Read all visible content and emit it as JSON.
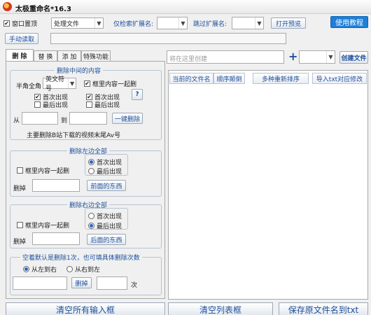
{
  "window": {
    "title": "太极重命名*16.3"
  },
  "toolbar": {
    "topmost_label": "窗口置顶",
    "topmost_checked": true,
    "mode_value": "处理文件",
    "ext_only_label": "仅检索扩展名:",
    "ext_skip_label": "跳过扩展名:",
    "preview_button": "打开预览",
    "tutorial_button": "使用教程",
    "manual_read_button": "手动读取"
  },
  "tabs": [
    "删 除",
    "替 换",
    "添 加",
    "特殊功能"
  ],
  "delete_middle": {
    "title": "删除中间的内容",
    "width_label": "半角全角",
    "symbol_value": "英文符号",
    "include_box_label": "框里内容一起删",
    "include_box_checked": true,
    "left_first": "首次出现",
    "left_last": "最后出现",
    "right_first": "首次出现",
    "right_last": "最后出现",
    "help_button": "?",
    "from_label": "从",
    "to_label": "到",
    "one_click_button": "一键删除",
    "note": "主要删除B站下载的视频末尾Av号"
  },
  "delete_left": {
    "title": "删除左边全部",
    "include_box_label": "框里内容一起删",
    "first_label": "首次出现",
    "last_label": "最后出现",
    "cut_label": "删掉",
    "front_button": "前面的东西"
  },
  "delete_right": {
    "title": "删除右边全部",
    "include_box_label": "框里内容一起删",
    "first_label": "首次出现",
    "last_label": "最后出现",
    "cut_label": "删掉",
    "back_button": "后面的东西"
  },
  "delete_count": {
    "title": "空着默认是删除1次，也可填具体删除次数",
    "left_to_right": "从左到右",
    "right_to_left": "从右到左",
    "cut_button": "删掉",
    "times_label": "次"
  },
  "right_panel": {
    "create_placeholder": "将在这里创建",
    "plus_icon": "+",
    "create_file_button": "创建文件",
    "columns": [
      "当前的文件名",
      "顺序颠倒",
      "多种重新排序",
      "导入txt对应修改"
    ]
  },
  "bottom": {
    "clear_inputs": "清空所有输入框",
    "clear_list": "清空列表框",
    "save_names": "保存原文件名到txt"
  }
}
